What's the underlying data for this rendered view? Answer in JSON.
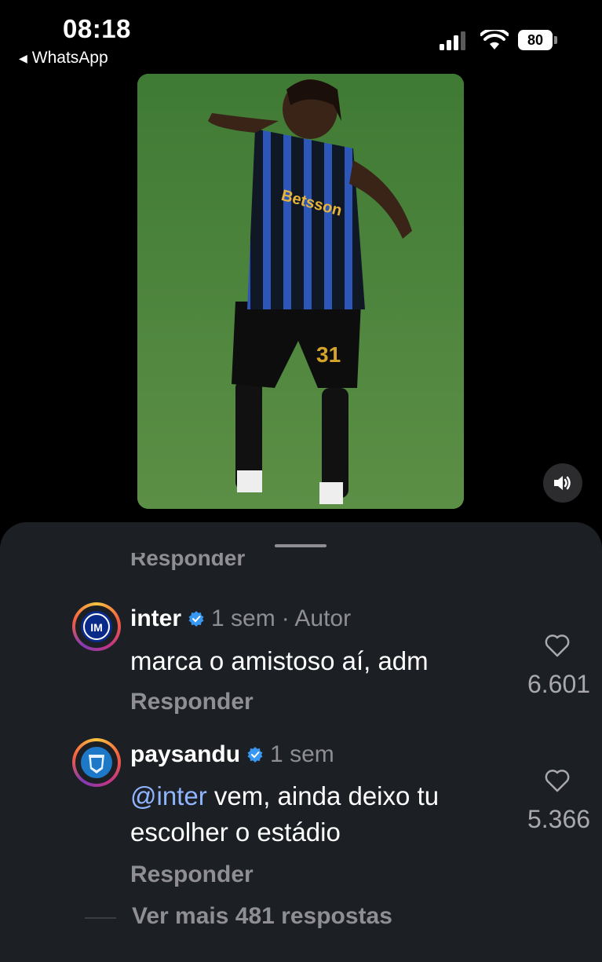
{
  "status_bar": {
    "time": "08:18",
    "back_app": "WhatsApp",
    "battery": "80",
    "icons": [
      "signal-icon",
      "wifi-icon",
      "battery-icon"
    ]
  },
  "video": {
    "jersey_number": "31",
    "sponsor_text": "Betsson",
    "mute_icon": "speaker-icon"
  },
  "sheet": {
    "reply_partial": "Responder",
    "comments": [
      {
        "username": "inter",
        "time": "1 sem",
        "author_tag": "· Autor",
        "text": "marca o amistoso aí, adm",
        "reply_label": "Responder",
        "likes": "6.601"
      },
      {
        "username": "paysandu",
        "time": "1 sem",
        "mention": "@inter",
        "text": " vem, ainda deixo tu escolher o estádio",
        "reply_label": "Responder",
        "likes": "5.366"
      }
    ],
    "more_replies": "Ver mais 481 respostas"
  },
  "colors": {
    "sheet_bg": "#1c1f24",
    "secondary_text": "#8e8e93",
    "mention": "#8fb5ff",
    "verified": "#3897f0"
  }
}
